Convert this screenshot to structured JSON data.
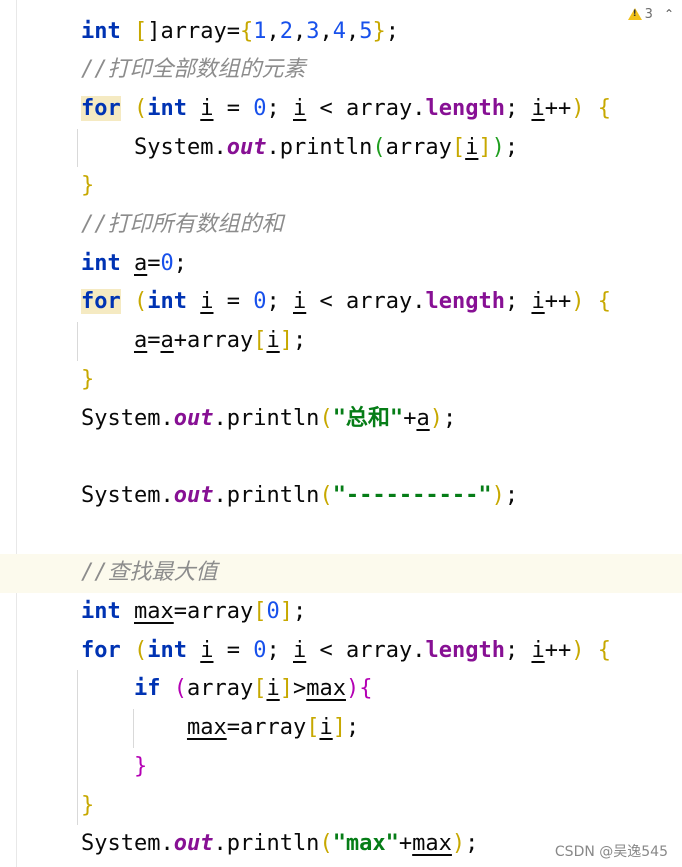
{
  "inspection": {
    "warning_count": "3",
    "warning_icon": "warning-triangle-icon",
    "nav_icon": "chevron-up-icon"
  },
  "watermark": "CSDN @吴逸545",
  "lines": [
    {
      "tokens": [
        {
          "t": "int",
          "c": "kw"
        },
        {
          "t": " "
        },
        {
          "t": "[",
          "c": "br1"
        },
        {
          "t": "]array="
        },
        {
          "t": "{",
          "c": "br1"
        },
        {
          "t": "1",
          "c": "num"
        },
        {
          "t": ","
        },
        {
          "t": "2",
          "c": "num"
        },
        {
          "t": ","
        },
        {
          "t": "3",
          "c": "num"
        },
        {
          "t": ","
        },
        {
          "t": "4",
          "c": "num"
        },
        {
          "t": ","
        },
        {
          "t": "5",
          "c": "num"
        },
        {
          "t": "}",
          "c": "br1"
        },
        {
          "t": ";"
        }
      ]
    },
    {
      "tokens": [
        {
          "t": "//打印全部数组的元素",
          "c": "cmt"
        }
      ]
    },
    {
      "tokens": [
        {
          "t": "for",
          "c": "kw for-hl"
        },
        {
          "t": " "
        },
        {
          "t": "(",
          "c": "br1"
        },
        {
          "t": "int",
          "c": "kw"
        },
        {
          "t": " "
        },
        {
          "t": "i",
          "c": "ul"
        },
        {
          "t": " = "
        },
        {
          "t": "0",
          "c": "num"
        },
        {
          "t": "; "
        },
        {
          "t": "i",
          "c": "ul"
        },
        {
          "t": " < array."
        },
        {
          "t": "length",
          "c": "fld"
        },
        {
          "t": "; "
        },
        {
          "t": "i",
          "c": "ul"
        },
        {
          "t": "++"
        },
        {
          "t": ")",
          "c": "br1"
        },
        {
          "t": " "
        },
        {
          "t": "{",
          "c": "br1"
        }
      ]
    },
    {
      "tokens": [
        {
          "t": "    System."
        },
        {
          "t": "out",
          "c": "sfld"
        },
        {
          "t": ".println"
        },
        {
          "t": "(",
          "c": "br2"
        },
        {
          "t": "array"
        },
        {
          "t": "[",
          "c": "br1"
        },
        {
          "t": "i",
          "c": "ul"
        },
        {
          "t": "]",
          "c": "br1"
        },
        {
          "t": ")",
          "c": "br2"
        },
        {
          "t": ";"
        }
      ]
    },
    {
      "tokens": [
        {
          "t": "}",
          "c": "br1"
        }
      ]
    },
    {
      "tokens": [
        {
          "t": "//打印所有数组的和",
          "c": "cmt"
        }
      ]
    },
    {
      "tokens": [
        {
          "t": "int",
          "c": "kw"
        },
        {
          "t": " "
        },
        {
          "t": "a",
          "c": "ul"
        },
        {
          "t": "="
        },
        {
          "t": "0",
          "c": "num"
        },
        {
          "t": ";"
        }
      ]
    },
    {
      "tokens": [
        {
          "t": "for",
          "c": "kw for-hl"
        },
        {
          "t": " "
        },
        {
          "t": "(",
          "c": "br1"
        },
        {
          "t": "int",
          "c": "kw"
        },
        {
          "t": " "
        },
        {
          "t": "i",
          "c": "ul"
        },
        {
          "t": " = "
        },
        {
          "t": "0",
          "c": "num"
        },
        {
          "t": "; "
        },
        {
          "t": "i",
          "c": "ul"
        },
        {
          "t": " < array."
        },
        {
          "t": "length",
          "c": "fld"
        },
        {
          "t": "; "
        },
        {
          "t": "i",
          "c": "ul"
        },
        {
          "t": "++"
        },
        {
          "t": ")",
          "c": "br1"
        },
        {
          "t": " "
        },
        {
          "t": "{",
          "c": "br1"
        }
      ]
    },
    {
      "tokens": [
        {
          "t": "    "
        },
        {
          "t": "a",
          "c": "ul"
        },
        {
          "t": "="
        },
        {
          "t": "a",
          "c": "ul"
        },
        {
          "t": "+array"
        },
        {
          "t": "[",
          "c": "br1"
        },
        {
          "t": "i",
          "c": "ul"
        },
        {
          "t": "]",
          "c": "br1"
        },
        {
          "t": ";"
        }
      ]
    },
    {
      "tokens": [
        {
          "t": "}",
          "c": "br1"
        }
      ]
    },
    {
      "tokens": [
        {
          "t": "System."
        },
        {
          "t": "out",
          "c": "sfld"
        },
        {
          "t": ".println"
        },
        {
          "t": "(",
          "c": "br1"
        },
        {
          "t": "\"总和\"",
          "c": "str"
        },
        {
          "t": "+"
        },
        {
          "t": "a",
          "c": "ul"
        },
        {
          "t": ")",
          "c": "br1"
        },
        {
          "t": ";"
        }
      ]
    },
    {
      "tokens": []
    },
    {
      "tokens": [
        {
          "t": "System."
        },
        {
          "t": "out",
          "c": "sfld"
        },
        {
          "t": ".println"
        },
        {
          "t": "(",
          "c": "br1"
        },
        {
          "t": "\"----------\"",
          "c": "str"
        },
        {
          "t": ")",
          "c": "br1"
        },
        {
          "t": ";"
        }
      ]
    },
    {
      "tokens": []
    },
    {
      "tokens": [
        {
          "t": "//查找最大值",
          "c": "cmt"
        }
      ],
      "highlight": true
    },
    {
      "tokens": [
        {
          "t": "int",
          "c": "kw"
        },
        {
          "t": " "
        },
        {
          "t": "max",
          "c": "ul"
        },
        {
          "t": "=array"
        },
        {
          "t": "[",
          "c": "br1"
        },
        {
          "t": "0",
          "c": "num"
        },
        {
          "t": "]",
          "c": "br1"
        },
        {
          "t": ";"
        }
      ]
    },
    {
      "tokens": [
        {
          "t": "for",
          "c": "kw"
        },
        {
          "t": " "
        },
        {
          "t": "(",
          "c": "br1"
        },
        {
          "t": "int",
          "c": "kw"
        },
        {
          "t": " "
        },
        {
          "t": "i",
          "c": "ul"
        },
        {
          "t": " = "
        },
        {
          "t": "0",
          "c": "num"
        },
        {
          "t": "; "
        },
        {
          "t": "i",
          "c": "ul"
        },
        {
          "t": " < array."
        },
        {
          "t": "length",
          "c": "fld"
        },
        {
          "t": "; "
        },
        {
          "t": "i",
          "c": "ul"
        },
        {
          "t": "++"
        },
        {
          "t": ")",
          "c": "br1"
        },
        {
          "t": " "
        },
        {
          "t": "{",
          "c": "br1"
        }
      ]
    },
    {
      "tokens": [
        {
          "t": "    "
        },
        {
          "t": "if",
          "c": "kw"
        },
        {
          "t": " "
        },
        {
          "t": "(",
          "c": "br3"
        },
        {
          "t": "array"
        },
        {
          "t": "[",
          "c": "br1"
        },
        {
          "t": "i",
          "c": "ul"
        },
        {
          "t": "]",
          "c": "br1"
        },
        {
          "t": ">"
        },
        {
          "t": "max",
          "c": "ul"
        },
        {
          "t": ")",
          "c": "br3"
        },
        {
          "t": "{",
          "c": "br3"
        }
      ]
    },
    {
      "tokens": [
        {
          "t": "        "
        },
        {
          "t": "max",
          "c": "ul"
        },
        {
          "t": "=array"
        },
        {
          "t": "[",
          "c": "br1"
        },
        {
          "t": "i",
          "c": "ul"
        },
        {
          "t": "]",
          "c": "br1"
        },
        {
          "t": ";"
        }
      ]
    },
    {
      "tokens": [
        {
          "t": "    "
        },
        {
          "t": "}",
          "c": "br3"
        }
      ]
    },
    {
      "tokens": [
        {
          "t": "}",
          "c": "br1"
        }
      ]
    },
    {
      "tokens": [
        {
          "t": "System."
        },
        {
          "t": "out",
          "c": "sfld"
        },
        {
          "t": ".println"
        },
        {
          "t": "(",
          "c": "br1"
        },
        {
          "t": "\"max\"",
          "c": "str"
        },
        {
          "t": "+"
        },
        {
          "t": "max",
          "c": "ul"
        },
        {
          "t": ")",
          "c": "br1"
        },
        {
          "t": ";"
        }
      ]
    }
  ]
}
